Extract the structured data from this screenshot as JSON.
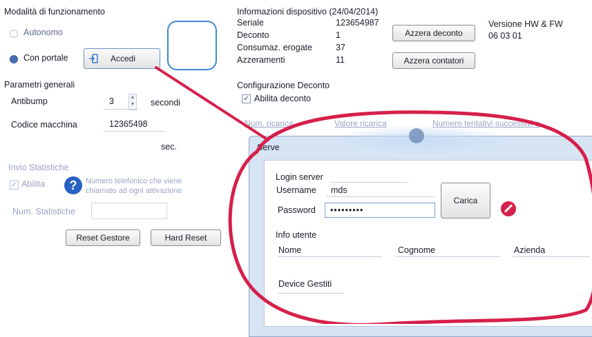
{
  "mode": {
    "title": "Modalità di funzionamento",
    "autonomo": "Autonomo",
    "con_portale": "Con portale",
    "accedi": "Accedi"
  },
  "general": {
    "title": "Parametri generali",
    "antibump_label": "Antibump",
    "antibump_value": "3",
    "antibump_unit": "secondi",
    "machine_label": "Codice macchina",
    "machine_value": "12365498",
    "sec": "sec."
  },
  "stats": {
    "title": "Invio Statistiche",
    "abilita": "Abilita",
    "help_text_1": "Numero telefonico che viene",
    "help_text_2": "chiamato ad ogni attivazione",
    "num_label": "Num. Statistiche"
  },
  "buttons": {
    "reset_gestore": "Reset Gestore",
    "hard_reset": "Hard Reset",
    "azzera_deconto": "Azzera deconto",
    "azzera_contatori": "Azzera contatori"
  },
  "device": {
    "title": "Informazioni dispositivo (24/04/2014)",
    "seriale_label": "Seriale",
    "seriale_value": "123654987",
    "deconto_label": "Deconto",
    "deconto_value": "1",
    "consumaz_label": "Consumaz. erogate",
    "consumaz_value": "37",
    "azzeramenti_label": "Azzeramenti",
    "azzeramenti_value": "11",
    "version_label": "Versione HW & FW",
    "version_value": "06 03 01"
  },
  "config": {
    "title": "Configurazione Deconto",
    "abilita_deconto": "Abilita deconto",
    "cols": [
      "Num. ricarica",
      "Valore ricarica",
      "Numero tentativi successivi a"
    ]
  },
  "dialog": {
    "title": "Serve",
    "login_server": "Login server",
    "username_label": "Username",
    "username_value": "mds",
    "password_label": "Password",
    "password_value": "•••••••••",
    "carica": "Carica",
    "info_utente": "Info utente",
    "nome": "Nome",
    "cognome": "Cognome",
    "azienda": "Azienda",
    "device_gestiti": "Device Gestiti"
  },
  "colors": {
    "annotation_red": "#d61f4a",
    "highlight_blue": "#3a8ad8",
    "help_blue": "#2a62c4"
  }
}
